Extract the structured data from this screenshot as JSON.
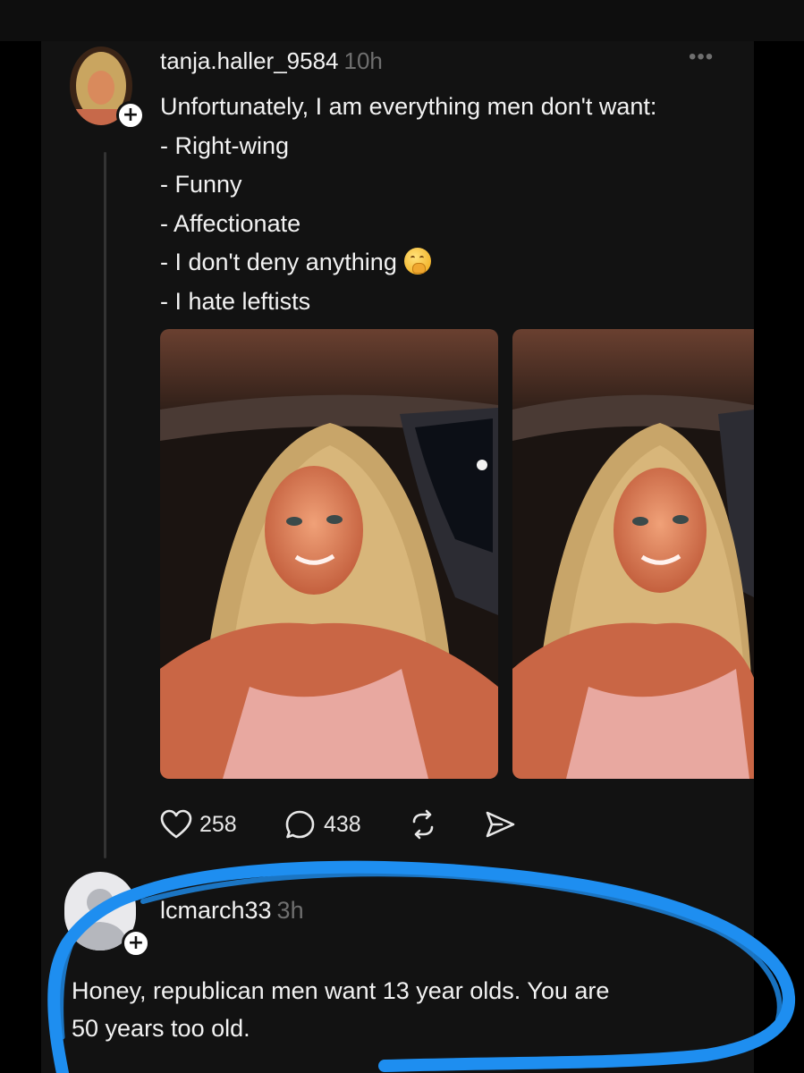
{
  "post": {
    "username": "tanja.haller_9584",
    "time": "10h",
    "more": "•••",
    "lines": [
      "Unfortunately, I am everything men don't want:",
      "- Right-wing",
      "- Funny",
      "- Affectionate",
      "- I don't deny anything",
      "- I hate leftists"
    ],
    "likes": "258",
    "comments": "438"
  },
  "reply": {
    "username": "lcmarch33",
    "time": "3h",
    "lines": [
      "Honey, republican men want 13 year olds. You are",
      "50 years too old."
    ]
  },
  "colors": {
    "panel_bg": "#121212",
    "text": "#f2f2f2",
    "muted": "#6f6f6f",
    "highlight_scribble": "#1e8ef0"
  },
  "icons": [
    "follow-plus-icon",
    "more-options-icon",
    "heart-icon",
    "comment-icon",
    "repost-icon",
    "share-icon",
    "shushing-face-emoji"
  ]
}
